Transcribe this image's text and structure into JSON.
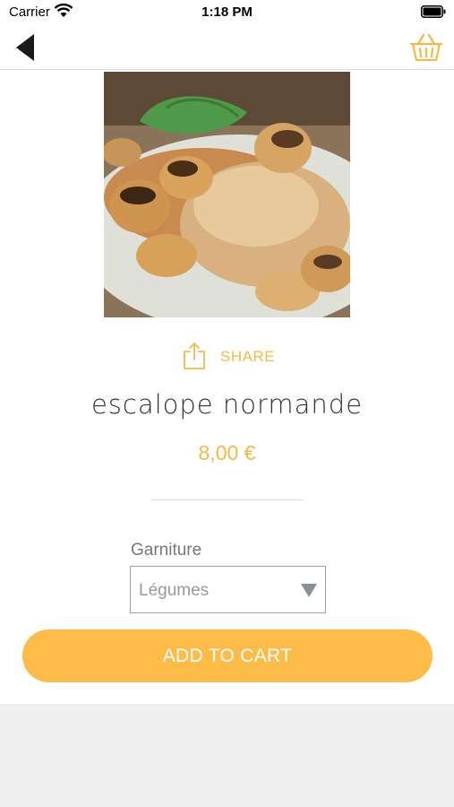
{
  "status_bar": {
    "carrier": "Carrier",
    "time": "1:18 PM"
  },
  "nav": {
    "back_icon": "back-arrow-icon",
    "cart_icon": "basket-icon"
  },
  "product": {
    "image": "escalope-with-mushrooms-photo",
    "name": "escalope normande",
    "price": "8,00 €"
  },
  "share": {
    "label": "SHARE",
    "icon": "share-icon"
  },
  "option": {
    "label": "Garniture",
    "selected": "Légumes"
  },
  "cart_button": {
    "label": "ADD TO CART"
  },
  "colors": {
    "accent": "#fdbb48",
    "accent_text": "#f5b944",
    "background": "#efefef"
  }
}
